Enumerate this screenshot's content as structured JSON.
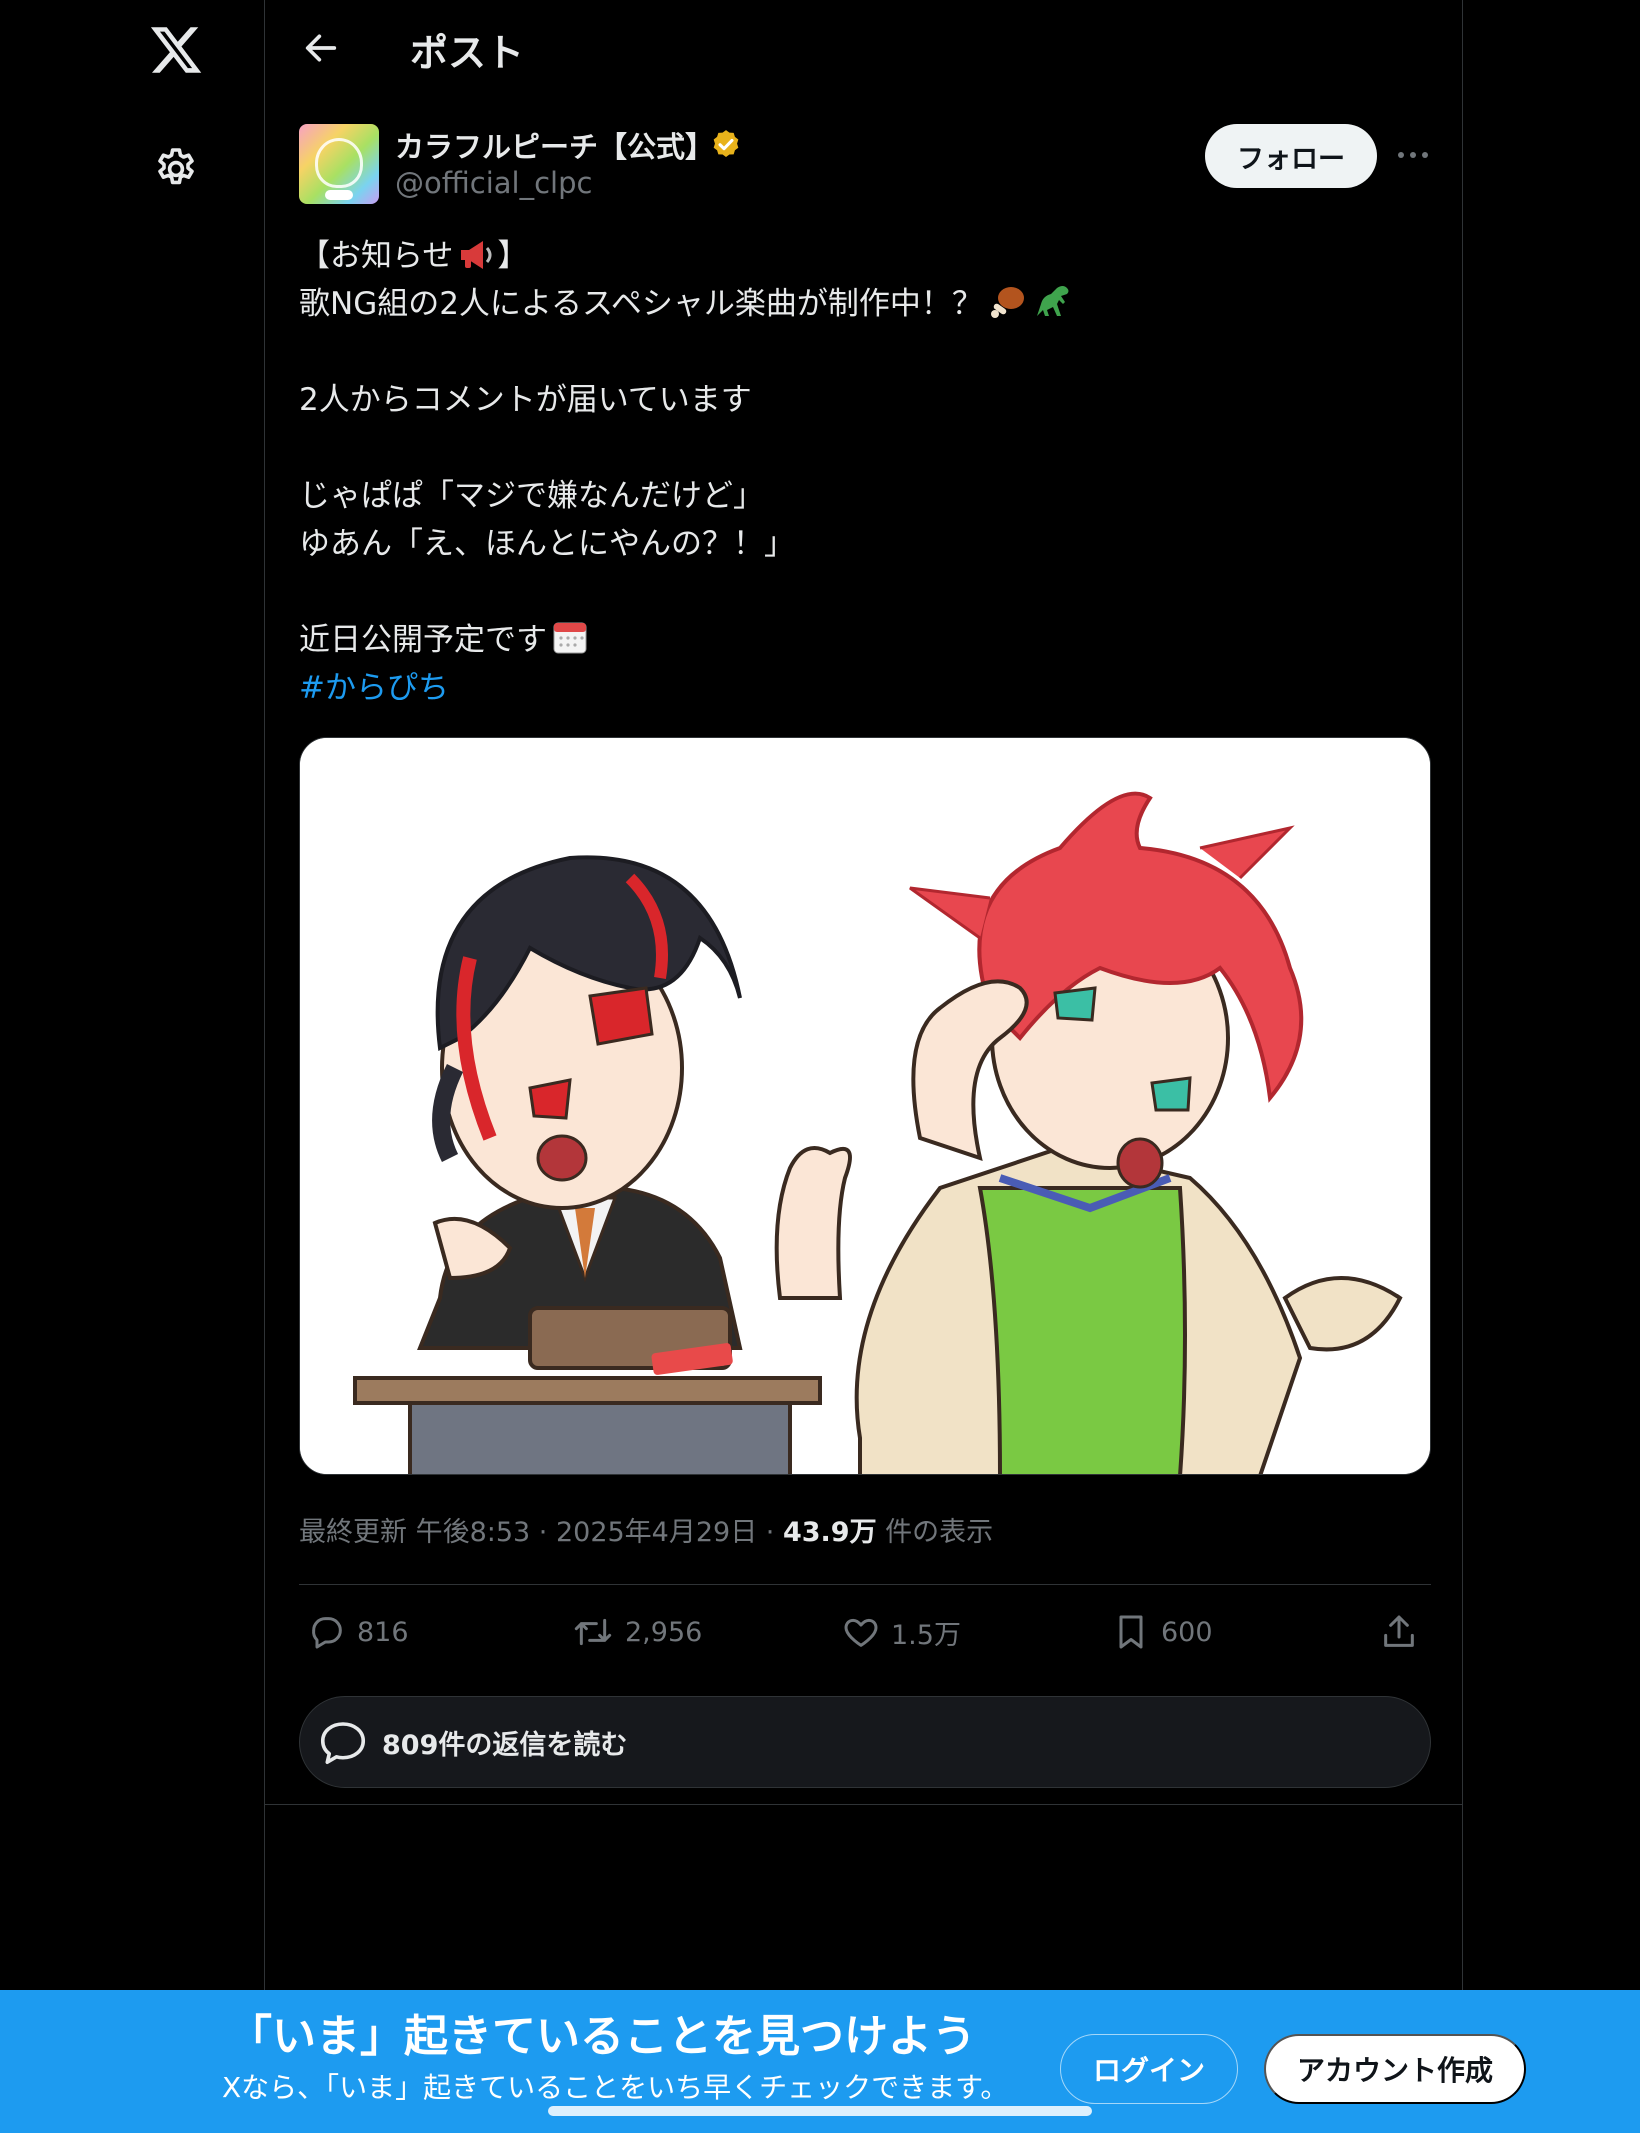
{
  "nav": {
    "page_title": "ポスト"
  },
  "post": {
    "author_name": "カラフルピーチ【公式】",
    "handle": "@official_clpc",
    "follow_label": "フォロー",
    "lines": [
      "【お知らせ",
      "歌NG組の2人によるスペシャル楽曲が制作中！？",
      "",
      "2人からコメントが届いています",
      "",
      "じゃぱぱ「マジで嫌なんだけど」",
      "ゆあん「え、ほんとにやんの？！」",
      "",
      "近日公開予定です"
    ],
    "line0_suffix": "】",
    "hashtag": "#からぴち",
    "meta_prefix": "最終更新 午後8:53 · 2025年4月29日 · ",
    "views": "43.9万",
    "views_suffix": " 件の表示",
    "stats": {
      "replies": "816",
      "reposts": "2,956",
      "likes": "1.5万",
      "bookmarks": "600"
    },
    "read_replies_label": "809件の返信を読む"
  },
  "banner": {
    "title": "「いま」起きていることを見つけよう",
    "subtitle": "Xなら、「いま」起きていることをいち早くチェックできます。",
    "login_label": "ログイン",
    "signup_label": "アカウント作成"
  },
  "colors": {
    "accent": "#1d9bf0",
    "background": "#000000",
    "verified": "#e8b21b"
  }
}
